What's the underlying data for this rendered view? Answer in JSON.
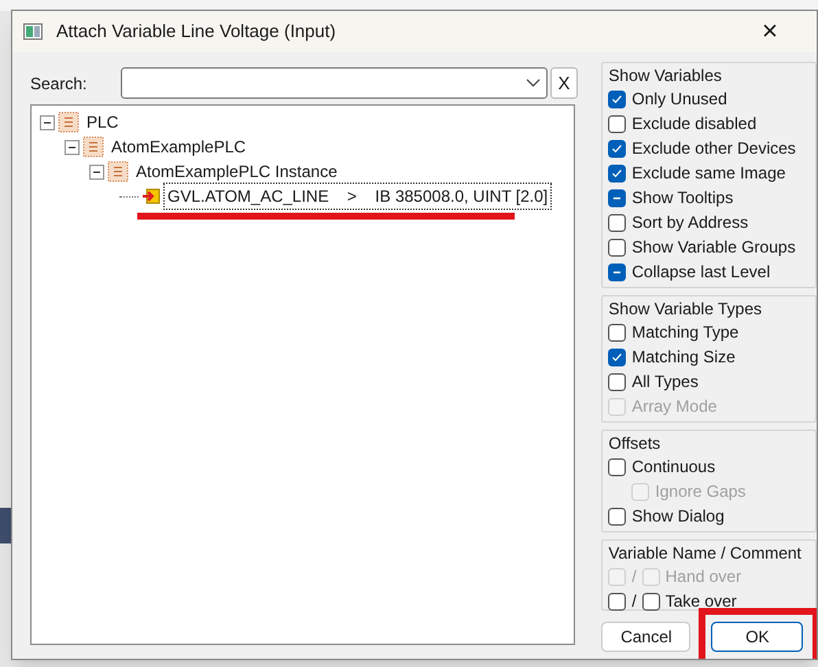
{
  "dialog": {
    "title": "Attach Variable Line Voltage (Input)",
    "close": "×"
  },
  "search": {
    "label": "Search:",
    "clear": "X"
  },
  "tree": [
    {
      "label": "PLC",
      "expanded": true,
      "children": [
        {
          "label": "AtomExamplePLC",
          "expanded": true,
          "children": [
            {
              "label": "AtomExamplePLC Instance",
              "expanded": true,
              "children": [
                {
                  "label": "GVL.ATOM_AC_LINE    >    IB 385008.0, UINT [2.0]",
                  "kind": "variable",
                  "selected": true,
                  "highlighted": true
                }
              ]
            }
          ]
        }
      ]
    }
  ],
  "groups": [
    {
      "title": "Show Variables",
      "options": [
        {
          "label": "Only Unused",
          "checked": true,
          "indeterminate": false,
          "disabled": false
        },
        {
          "label": "Exclude disabled",
          "checked": false,
          "indeterminate": false,
          "disabled": false
        },
        {
          "label": "Exclude other Devices",
          "checked": true,
          "indeterminate": false,
          "disabled": false
        },
        {
          "label": "Exclude same Image",
          "checked": true,
          "indeterminate": false,
          "disabled": false
        },
        {
          "label": "Show Tooltips",
          "checked": false,
          "indeterminate": true,
          "disabled": false
        },
        {
          "label": "Sort by Address",
          "checked": false,
          "indeterminate": false,
          "disabled": false
        },
        {
          "label": "Show Variable Groups",
          "checked": false,
          "indeterminate": false,
          "disabled": false
        },
        {
          "label": "Collapse last Level",
          "checked": false,
          "indeterminate": true,
          "disabled": false
        }
      ]
    },
    {
      "title": "Show Variable Types",
      "options": [
        {
          "label": "Matching Type",
          "checked": false,
          "indeterminate": false,
          "disabled": false
        },
        {
          "label": "Matching Size",
          "checked": true,
          "indeterminate": false,
          "disabled": false
        },
        {
          "label": "All Types",
          "checked": false,
          "indeterminate": false,
          "disabled": false
        },
        {
          "label": "Array Mode",
          "checked": false,
          "indeterminate": false,
          "disabled": true
        }
      ]
    },
    {
      "title": "Offsets",
      "options": [
        {
          "label": "Continuous",
          "checked": false,
          "indeterminate": false,
          "disabled": false,
          "indented": false
        },
        {
          "label": "Ignore Gaps",
          "checked": false,
          "indeterminate": false,
          "disabled": true,
          "indented": true
        },
        {
          "label": "Show Dialog",
          "checked": false,
          "indeterminate": false,
          "disabled": false,
          "indented": false
        }
      ]
    }
  ],
  "name_comment": {
    "title": "Variable Name / Comment",
    "rows": [
      {
        "separator": "/",
        "label": "Hand over",
        "disabled": true
      },
      {
        "separator": "/",
        "label": "Take over",
        "disabled": false
      }
    ]
  },
  "buttons": [
    {
      "label": "Cancel",
      "default": false
    },
    {
      "label": "OK",
      "default": true,
      "highlighted": true
    }
  ]
}
